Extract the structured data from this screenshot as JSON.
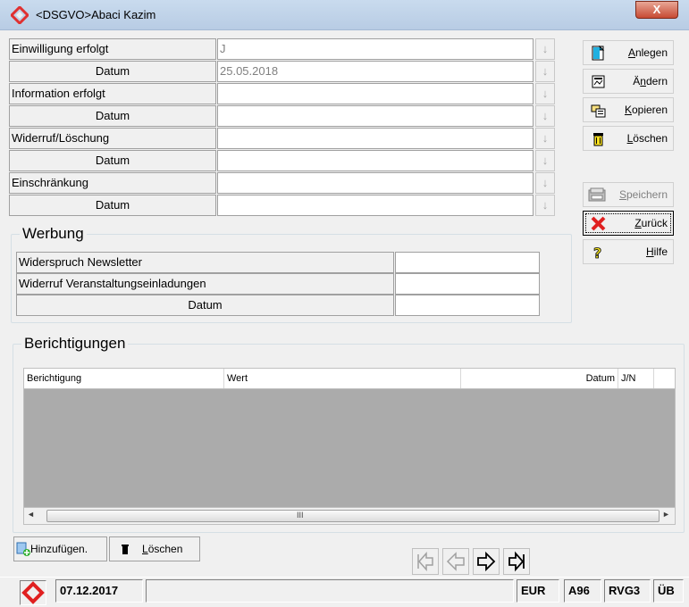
{
  "window": {
    "title": "<DSGVO>Abaci Kazim",
    "close_label": "X"
  },
  "form": {
    "rows": [
      {
        "label": "Einwilligung erfolgt",
        "value": "J",
        "centered": false
      },
      {
        "label": "Datum",
        "value": "25.05.2018",
        "centered": true
      },
      {
        "label": "Information erfolgt",
        "value": "",
        "centered": false
      },
      {
        "label": "Datum",
        "value": "",
        "centered": true
      },
      {
        "label": "Widerruf/Löschung",
        "value": "",
        "centered": false
      },
      {
        "label": "Datum",
        "value": "",
        "centered": true
      },
      {
        "label": "Einschränkung",
        "value": "",
        "centered": false
      },
      {
        "label": "Datum",
        "value": "",
        "centered": true
      }
    ],
    "dropdown_glyph": "↓"
  },
  "buttons": {
    "anlegen": "Anlegen",
    "aendern": "Ändern",
    "kopieren": "Kopieren",
    "loeschen": "Löschen",
    "speichern": "Speichern",
    "zurueck": "Zurück",
    "hilfe": "Hilfe"
  },
  "werbung": {
    "title": "Werbung",
    "rows": [
      {
        "label": "Widerspruch Newsletter",
        "value": ""
      },
      {
        "label": "Widerruf Veranstaltungseinladungen",
        "value": ""
      },
      {
        "label": "Datum",
        "value": ""
      }
    ]
  },
  "berichtigungen": {
    "title": "Berichtigungen",
    "columns": [
      "Berichtigung",
      "Wert",
      "Datum",
      "J/N"
    ],
    "scroll_grip": "III"
  },
  "bottom": {
    "add_label": "Hinzufügen.",
    "delete_label": "Löschen"
  },
  "status": {
    "date": "07.12.2017",
    "info": "",
    "currency": "EUR",
    "code1": "A96",
    "code2": "RVG3",
    "code3": "ÜB"
  }
}
